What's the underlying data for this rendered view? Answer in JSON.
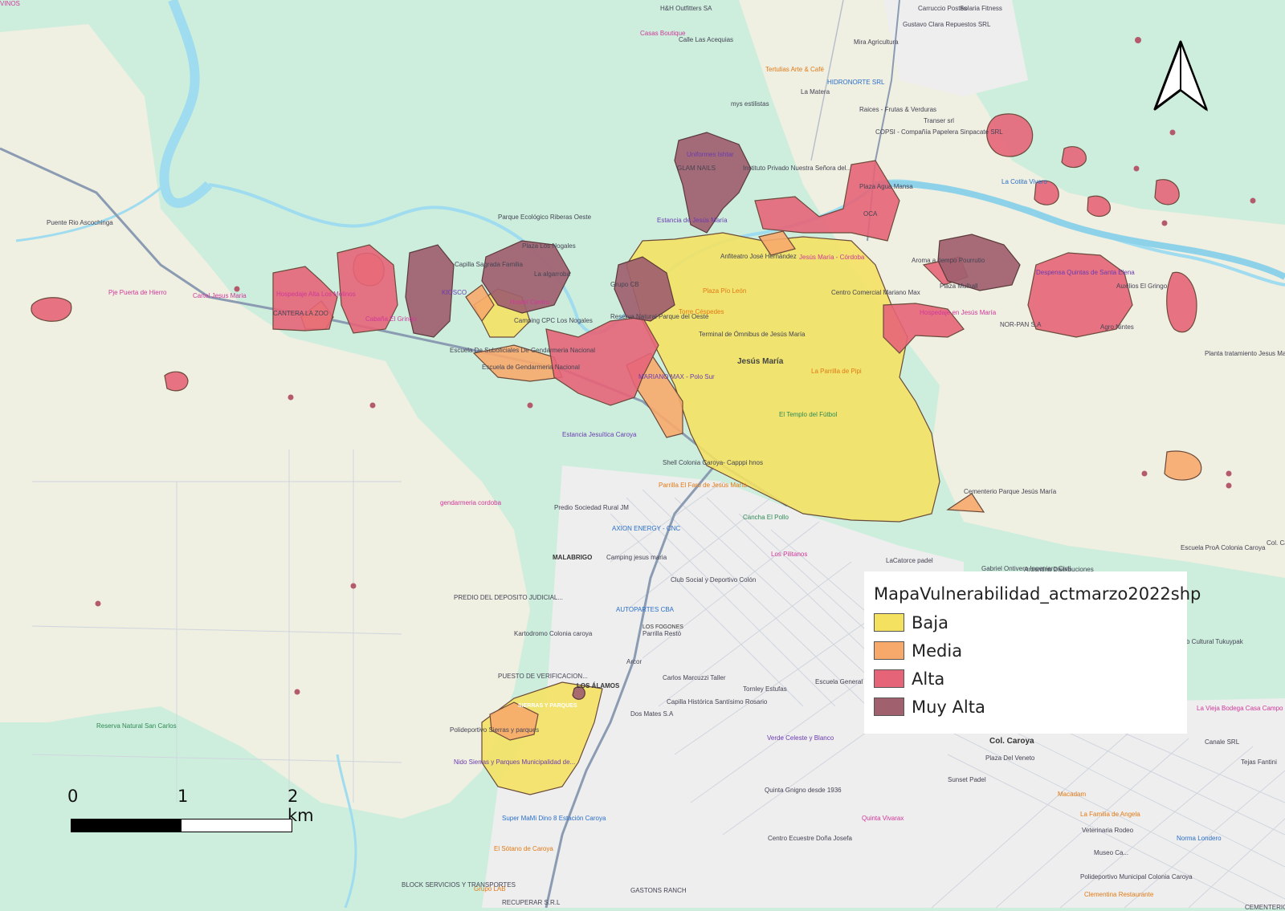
{
  "legend": {
    "title": "MapaVulnerabilidad_actmarzo2022shp",
    "items": [
      {
        "label": "Baja",
        "color": "#f5e160"
      },
      {
        "label": "Media",
        "color": "#f7a96c"
      },
      {
        "label": "Alta",
        "color": "#e56478"
      },
      {
        "label": "Muy Alta",
        "color": "#a0606e"
      }
    ]
  },
  "scale": {
    "labels": [
      "0",
      "1",
      "2 km"
    ]
  },
  "colors": {
    "land": "#cdeedd",
    "fields": "#efefe2",
    "urban": "#eeeeee",
    "river": "#9fdcef",
    "road": "#8a9bb2"
  },
  "places": {
    "jesus_maria": "Jesús María",
    "colonia_caroya": "Col. Caroya",
    "malabrigo": "MALABRIGO",
    "los_alamos": "LOS ÁLAMOS",
    "los_fogones": "LOS FOGONES",
    "sierras_parques": "SIERRAS Y PARQUES"
  },
  "pois": [
    {
      "label": "H&H Outfitters SA",
      "cls": "poi"
    },
    {
      "label": "Casas Boutique",
      "cls": "poi-pink"
    },
    {
      "label": "Calle Las Acequias",
      "cls": "poi"
    },
    {
      "label": "Tertulias Arte & Café",
      "cls": "poi-orange"
    },
    {
      "label": "La Matera",
      "cls": "poi"
    },
    {
      "label": "mys estilistas",
      "cls": "poi"
    },
    {
      "label": "HIDRONORTE SRL",
      "cls": "poi-blue"
    },
    {
      "label": "Carruccio Postes",
      "cls": "poi"
    },
    {
      "label": "Gustavo Clara Repuestos SRL",
      "cls": "poi"
    },
    {
      "label": "Mira Agricultura",
      "cls": "poi"
    },
    {
      "label": "Solaria Fitness",
      "cls": "poi"
    },
    {
      "label": "Raices - Frutas & Verduras",
      "cls": "poi"
    },
    {
      "label": "COPSI - Compañía Papelera Sinpacate SRL",
      "cls": "poi"
    },
    {
      "label": "Transer srl",
      "cls": "poi"
    },
    {
      "label": "La Cotita Vivero",
      "cls": "poi-blue"
    },
    {
      "label": "Uniformes Ishtar",
      "cls": "poi-purple"
    },
    {
      "label": "GLAM NAILS",
      "cls": "poi"
    },
    {
      "label": "Instituto Privado Nuestra Señora del...",
      "cls": "poi"
    },
    {
      "label": "Estancia de Jesús María",
      "cls": "poi-purple"
    },
    {
      "label": "Plaza Agua Mansa",
      "cls": "poi"
    },
    {
      "label": "OCA",
      "cls": "poi"
    },
    {
      "label": "Parque Ecológico Riberas Oeste",
      "cls": "poi"
    },
    {
      "label": "Plaza Los Nogales",
      "cls": "poi"
    },
    {
      "label": "Capilla Sagrada Familia",
      "cls": "poi"
    },
    {
      "label": "La algarroba",
      "cls": "poi"
    },
    {
      "label": "Puente Rio Ascochinga",
      "cls": "poi"
    },
    {
      "label": "Pje Puerta de Hierro",
      "cls": "poi-pink"
    },
    {
      "label": "Cartel Jesus Maria",
      "cls": "poi-pink"
    },
    {
      "label": "Hospedaje Alta Los Molinos",
      "cls": "poi-pink"
    },
    {
      "label": "Cabaña El Gringo",
      "cls": "poi-pink"
    },
    {
      "label": "CANTERA LA ZOO",
      "cls": "poi"
    },
    {
      "label": "KIOSCO",
      "cls": "poi-purple"
    },
    {
      "label": "Hostel Centro",
      "cls": "poi-pink"
    },
    {
      "label": "Grupo CB",
      "cls": "poi"
    },
    {
      "label": "Anfiteatro José Hernández",
      "cls": "poi"
    },
    {
      "label": "Jesús María - Córdoba",
      "cls": "poi-pink"
    },
    {
      "label": "Plaza Pío León",
      "cls": "poi-orange"
    },
    {
      "label": "Centro Comercial Mariano Max",
      "cls": "poi"
    },
    {
      "label": "Reserva Natural Parque del Oeste",
      "cls": "poi"
    },
    {
      "label": "Torre Céspedes",
      "cls": "poi-orange"
    },
    {
      "label": "Terminal de Ómnibus de Jesús María",
      "cls": "poi"
    },
    {
      "label": "Escuela De Suboficiales De Gendarmeria Nacional",
      "cls": "poi"
    },
    {
      "label": "Escuela de Gendarmeria Nacional",
      "cls": "poi"
    },
    {
      "label": "Camping CPC Los Nogales",
      "cls": "poi"
    },
    {
      "label": "MARIANO MAX - Polo Sur",
      "cls": "poi-purple"
    },
    {
      "label": "La Parrilla de Pipi",
      "cls": "poi-orange"
    },
    {
      "label": "El Templo del Fútbol",
      "cls": "poi-green"
    },
    {
      "label": "Hospedaje en Jesús María",
      "cls": "poi-pink"
    },
    {
      "label": "Cementerio Parque Jesús María",
      "cls": "poi"
    },
    {
      "label": "Plaza Mulhall",
      "cls": "poi"
    },
    {
      "label": "Aroma a tiempo Pourrutio",
      "cls": "poi"
    },
    {
      "label": "Despensa Quintas de Santa Elena",
      "cls": "poi-purple"
    },
    {
      "label": "Auxilios El Gringo",
      "cls": "poi"
    },
    {
      "label": "NOR-PAN S.A",
      "cls": "poi"
    },
    {
      "label": "Agro Nintes",
      "cls": "poi"
    },
    {
      "label": "Planta tratamiento Jesus Maria",
      "cls": "poi"
    },
    {
      "label": "Estancia Jesuítica Caroya",
      "cls": "poi-purple"
    },
    {
      "label": "Shell Colonia Caroya- Capppi hnos",
      "cls": "poi"
    },
    {
      "label": "Parrilla El Faro de Jesús María",
      "cls": "poi-orange"
    },
    {
      "label": "gendarmeria cordoba",
      "cls": "poi-pink"
    },
    {
      "label": "Predio Sociedad Rural JM",
      "cls": "poi"
    },
    {
      "label": "AXION ENERGY - CNC",
      "cls": "poi-blue"
    },
    {
      "label": "Cancha El Pollo",
      "cls": "poi-green"
    },
    {
      "label": "Camping jesus maria",
      "cls": "poi"
    },
    {
      "label": "Los Pilitanos",
      "cls": "poi-pink"
    },
    {
      "label": "LaCatorce padel",
      "cls": "poi"
    },
    {
      "label": "Club Social y Deportivo Colón",
      "cls": "poi"
    },
    {
      "label": "AUTOPARTES CBA",
      "cls": "poi-blue"
    },
    {
      "label": "PREDIO DEL DEPOSITO JUDICIAL...",
      "cls": "poi"
    },
    {
      "label": "Kartodromo Colonia caroya",
      "cls": "poi"
    },
    {
      "label": "Parrilla Restó",
      "cls": "poi"
    },
    {
      "label": "Arcor",
      "cls": "poi"
    },
    {
      "label": "Carlos Marcuzzi Taller",
      "cls": "poi"
    },
    {
      "label": "PUESTO DE VERIFICACION...",
      "cls": "poi"
    },
    {
      "label": "Tornley Estufas",
      "cls": "poi"
    },
    {
      "label": "Escuela General Manuel Belgrano",
      "cls": "poi"
    },
    {
      "label": "Capilla Histórica Santísimo Rosario",
      "cls": "poi"
    },
    {
      "label": "Dos Mates S.A",
      "cls": "poi"
    },
    {
      "label": "Verde Celeste y Blanco",
      "cls": "poi-purple"
    },
    {
      "label": "Polideportivo Sierras y parques",
      "cls": "poi"
    },
    {
      "label": "Nido Sierras y Parques Municipalidad de...",
      "cls": "poi-purple"
    },
    {
      "label": "Reserva Natural San Carlos",
      "cls": "poi-green"
    },
    {
      "label": "Super MaMi Dino 8 Estación Caroya",
      "cls": "poi-blue"
    },
    {
      "label": "El Sótano de Caroya",
      "cls": "poi-orange"
    },
    {
      "label": "Grupo LAB",
      "cls": "poi-orange"
    },
    {
      "label": "BLOCK SERVICIOS Y TRANSPORTES",
      "cls": "poi"
    },
    {
      "label": "GASTONS RANCH",
      "cls": "poi"
    },
    {
      "label": "RECUPERAR S.R.L",
      "cls": "poi"
    },
    {
      "label": "Quinta Gnigno desde 1936",
      "cls": "poi"
    },
    {
      "label": "Centro Ecuestre Doña Josefa",
      "cls": "poi"
    },
    {
      "label": "Quinta Vivarax",
      "cls": "poi-pink"
    },
    {
      "label": "Sunset Padel",
      "cls": "poi"
    },
    {
      "label": "Plaza Del Veneto",
      "cls": "poi"
    },
    {
      "label": "Macadam",
      "cls": "poi-orange"
    },
    {
      "label": "La Familia de Angela",
      "cls": "poi-orange"
    },
    {
      "label": "Veterinaria Rodeo",
      "cls": "poi"
    },
    {
      "label": "Norma Londero",
      "cls": "poi-blue"
    },
    {
      "label": "Polideportivo Municipal Colonia Caroya",
      "cls": "poi"
    },
    {
      "label": "Clementina Restaurante",
      "cls": "poi-orange"
    },
    {
      "label": "Argentina Distribuciones",
      "cls": "poi"
    },
    {
      "label": "Gabriel Ontivero Ingeniero Civil",
      "cls": "poi"
    },
    {
      "label": "Escuela ProA Colonia Caroya",
      "cls": "poi"
    },
    {
      "label": "Club Cultural Tukuypak",
      "cls": "poi"
    },
    {
      "label": "La Vieja Bodega Casa Campo",
      "cls": "poi-pink"
    },
    {
      "label": "Canale SRL",
      "cls": "poi"
    },
    {
      "label": "Tejas Fantini",
      "cls": "poi"
    },
    {
      "label": "CEMENTERIO COLONIA CAROYA",
      "cls": "poi"
    },
    {
      "label": "Museo Ca...",
      "cls": "poi"
    },
    {
      "label": "Col. Caroya",
      "cls": "poi"
    },
    {
      "label": "VINOS",
      "cls": "poi-pink"
    }
  ]
}
